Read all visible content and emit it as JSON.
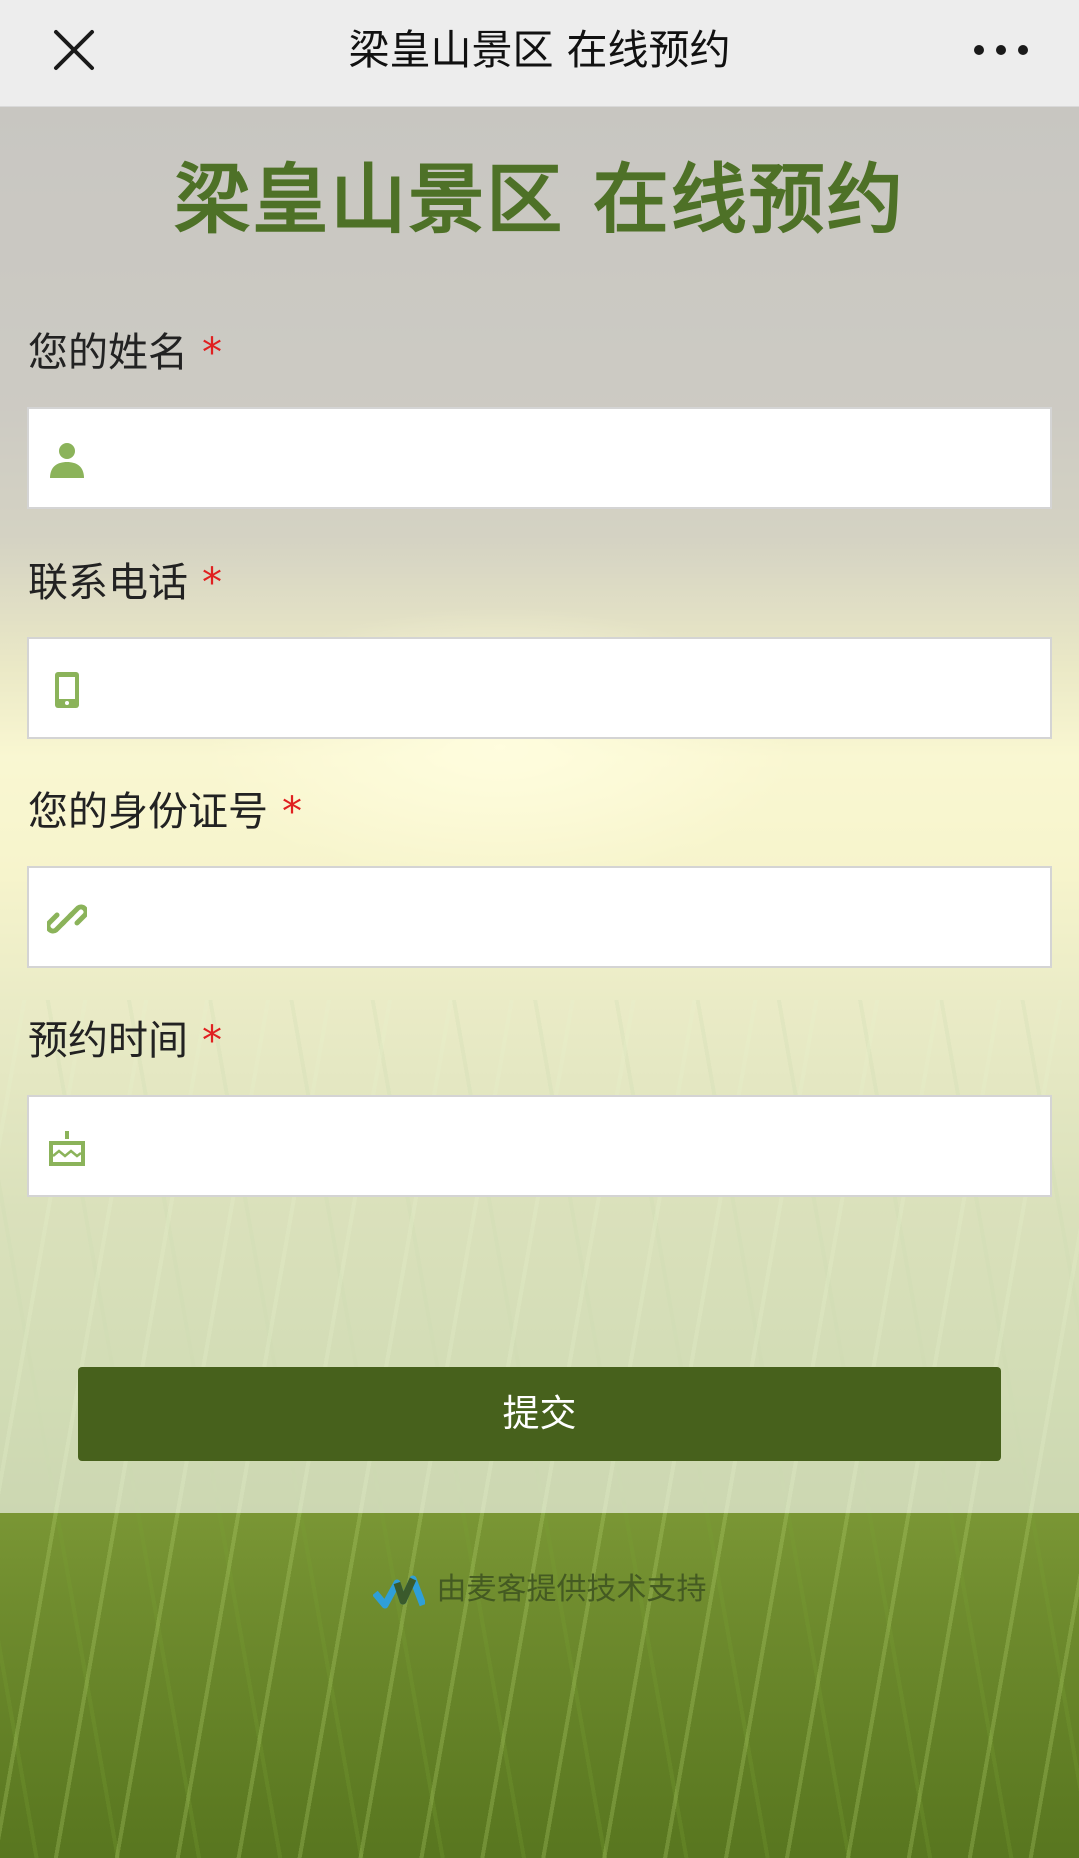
{
  "topbar": {
    "title": "梁皇山景区 在线预约",
    "close_icon": "close-icon",
    "more_icon": "more-dots-icon"
  },
  "form": {
    "title": "梁皇山景区 在线预约",
    "required_mark": "*",
    "fields": [
      {
        "label": "您的姓名",
        "icon": "user-icon",
        "value": ""
      },
      {
        "label": "联系电话",
        "icon": "phone-icon",
        "value": ""
      },
      {
        "label": "您的身份证号",
        "icon": "link-icon",
        "value": ""
      },
      {
        "label": "预约时间",
        "icon": "cake-icon",
        "value": ""
      }
    ],
    "submit_label": "提交"
  },
  "footer": {
    "text": "由麦客提供技术支持",
    "logo_icon": "maike-logo-icon"
  },
  "colors": {
    "title_green": "#4e7127",
    "icon_green": "#8bb35a",
    "button_green": "#47611c",
    "required_red": "#e02020"
  }
}
